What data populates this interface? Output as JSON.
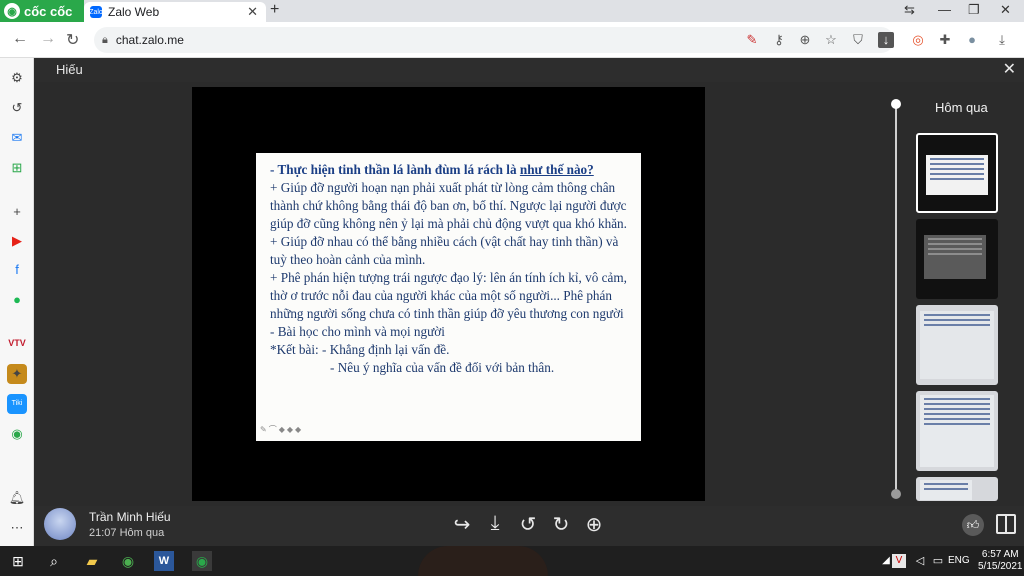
{
  "browser": {
    "brand_tab": "cốc cốc",
    "tab_title": "Zalo Web",
    "url": "chat.zalo.me"
  },
  "viewer": {
    "title": "Hiếu",
    "date_group": "Hôm qua",
    "sender_name": "Trần Minh Hiếu",
    "sent_time": "21:07 Hôm qua"
  },
  "slide": {
    "heading_prefix": "- Thực hiện tinh thần lá lành đùm lá rách là ",
    "heading_underlined": "như thế nào?",
    "lines": [
      " + Giúp đỡ người hoạn nạn phải xuất phát từ lòng cảm thông chân thành chứ không bằng thái độ ban ơn, bố thí. Ngược lại người được giúp đỡ cũng không nên ỷ lại mà phải chủ động vượt qua khó khăn.",
      " + Giúp đỡ nhau có thể bằng nhiều cách (vật chất hay tinh thần) và tuỳ theo hoàn cảnh của mình.",
      "+ Phê phán hiện tượng trái ngược đạo lý: lên án tính ích kỉ, vô cảm, thờ ơ trước nỗi đau của người khác của một số người... Phê phán những người sống chưa có tinh thần giúp đỡ yêu thương con người",
      "- Bài học cho mình và mọi người"
    ],
    "conclusion": "*Kết bài: -  Khẳng định lại vấn đề.",
    "conclusion_2": "- Nêu ý nghĩa của vấn đề đối với bản thân."
  },
  "taskbar": {
    "language": "ENG",
    "time": "6:57 AM",
    "date": "5/15/2021"
  },
  "icons": {
    "sidebar": [
      "gear-icon",
      "history-icon",
      "messenger-icon",
      "game-icon",
      "add-icon",
      "youtube-icon",
      "facebook-icon",
      "spotify-icon",
      "vtv-icon",
      "game-app-icon",
      "tiki-icon",
      "coccoc-app-icon",
      "bell-icon",
      "more-icon"
    ],
    "viewer_tools": [
      "share-icon",
      "download-icon",
      "rotate-left-icon",
      "rotate-right-icon",
      "zoom-in-icon"
    ]
  },
  "colors": {
    "coccoc_green": "#2aa84a",
    "slide_text": "#1e3a6e"
  }
}
